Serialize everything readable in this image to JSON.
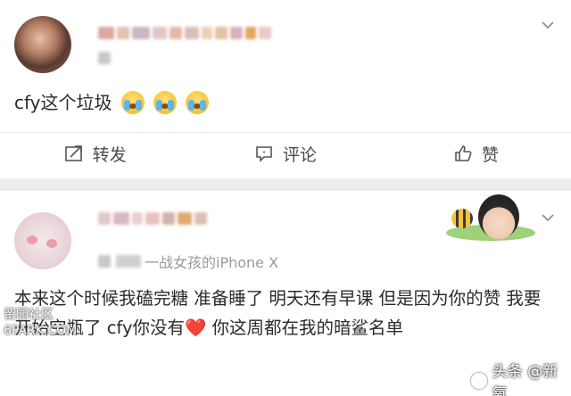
{
  "post1": {
    "text": "cfy这个垃圾",
    "emoji": [
      "crying-face",
      "crying-face",
      "crying-face"
    ],
    "actions": {
      "repost_label": "转发",
      "comment_label": "评论",
      "like_label": "赞"
    }
  },
  "post2": {
    "source": "一战女孩的iPhone X",
    "text_part1": "本来这个时候我磕完糖 准备睡了 明天还有早课 但是因为你的赞 我要开始空瓶了 cfy你没有",
    "heart": "❤️",
    "text_part2": " 你这周都在我的暗鲨名单"
  },
  "watermark": {
    "left_line1": "留园社区",
    "left_line2": "6PARK.COM",
    "right_label": "头条 @新氧"
  },
  "colors": {
    "card_bg": "#ffffff",
    "page_bg": "#ececec",
    "text": "#2b2b2b",
    "muted": "#9a9a9a",
    "heart": "#e54646"
  }
}
